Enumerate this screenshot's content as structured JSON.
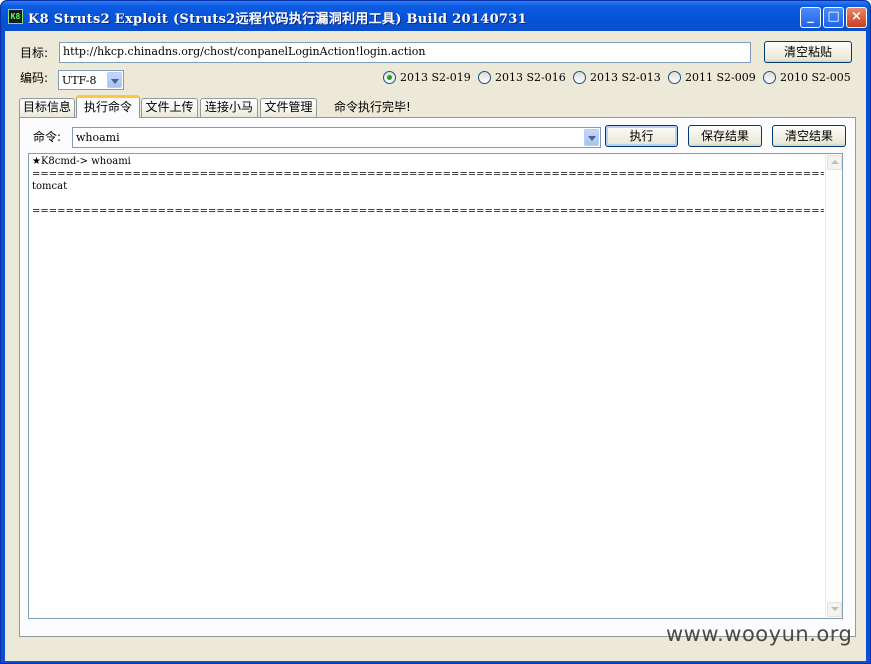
{
  "window": {
    "icon_text": "K8",
    "title": "K8 Struts2 Exploit (Struts2远程代码执行漏洞利用工具)  Build 20140731",
    "minimize": "_",
    "maximize": "□",
    "close": "×"
  },
  "target": {
    "label": "目标:",
    "value": "http://hkcp.chinadns.org/chost/conpanelLoginAction!login.action",
    "clear_paste_button": "清空粘贴"
  },
  "encoding": {
    "label": "编码:",
    "value": "UTF-8"
  },
  "vuln_options": [
    {
      "label": "2013 S2-019",
      "selected": true
    },
    {
      "label": "2013 S2-016",
      "selected": false
    },
    {
      "label": "2013 S2-013",
      "selected": false
    },
    {
      "label": "2011 S2-009",
      "selected": false
    },
    {
      "label": "2010 S2-005",
      "selected": false
    }
  ],
  "tabs": [
    {
      "label": "目标信息",
      "active": false
    },
    {
      "label": "执行命令",
      "active": true
    },
    {
      "label": "文件上传",
      "active": false
    },
    {
      "label": "连接小马",
      "active": false
    },
    {
      "label": "文件管理",
      "active": false
    }
  ],
  "status_text": "命令执行完毕!",
  "command": {
    "label": "命令:",
    "value": "whoami",
    "execute_button": "执行",
    "save_button": "保存结果",
    "clear_button": "清空结果"
  },
  "output": {
    "prompt_line": "★K8cmd-> whoami",
    "separator": "================================================================================================================================================",
    "result": "tomcat"
  },
  "watermark": "www.wooyun.org"
}
